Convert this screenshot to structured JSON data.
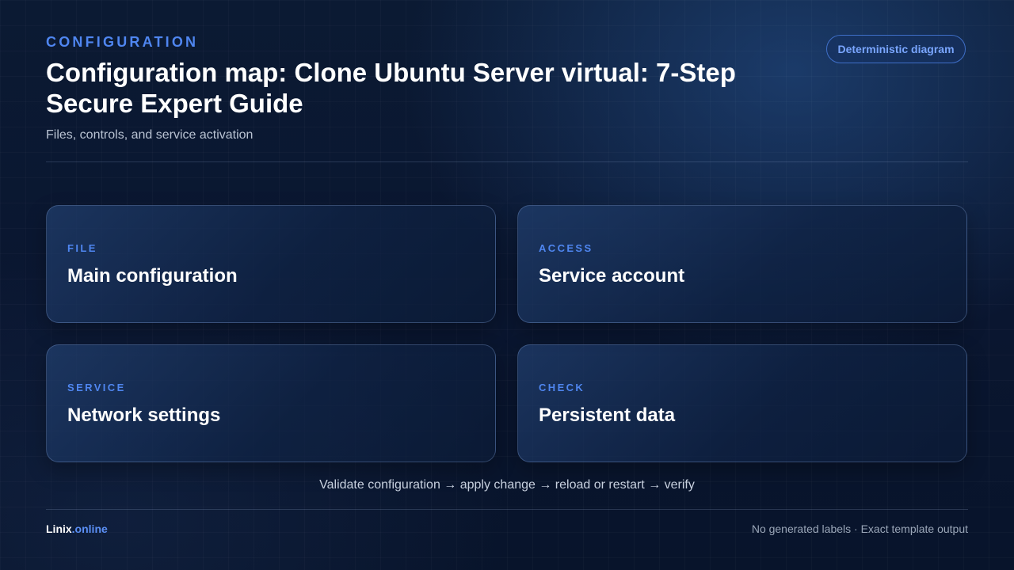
{
  "header": {
    "eyebrow": "CONFIGURATION",
    "title": "Configuration map: Clone Ubuntu Server virtual: 7-Step Secure Expert Guide",
    "subtitle": "Files, controls, and service activation",
    "badge": "Deterministic diagram"
  },
  "cards": [
    {
      "category": "FILE",
      "label": "Main configuration"
    },
    {
      "category": "ACCESS",
      "label": "Service account"
    },
    {
      "category": "SERVICE",
      "label": "Network settings"
    },
    {
      "category": "CHECK",
      "label": "Persistent data"
    }
  ],
  "flow": "Validate configuration → apply change → reload or restart → verify",
  "footer": {
    "brand_name": "Linix",
    "brand_tld": ".online",
    "note": "No generated labels · Exact template output"
  },
  "colors": {
    "accent": "#4f86f0",
    "background": "#0a1630",
    "card_border": "#7d9bcd"
  }
}
